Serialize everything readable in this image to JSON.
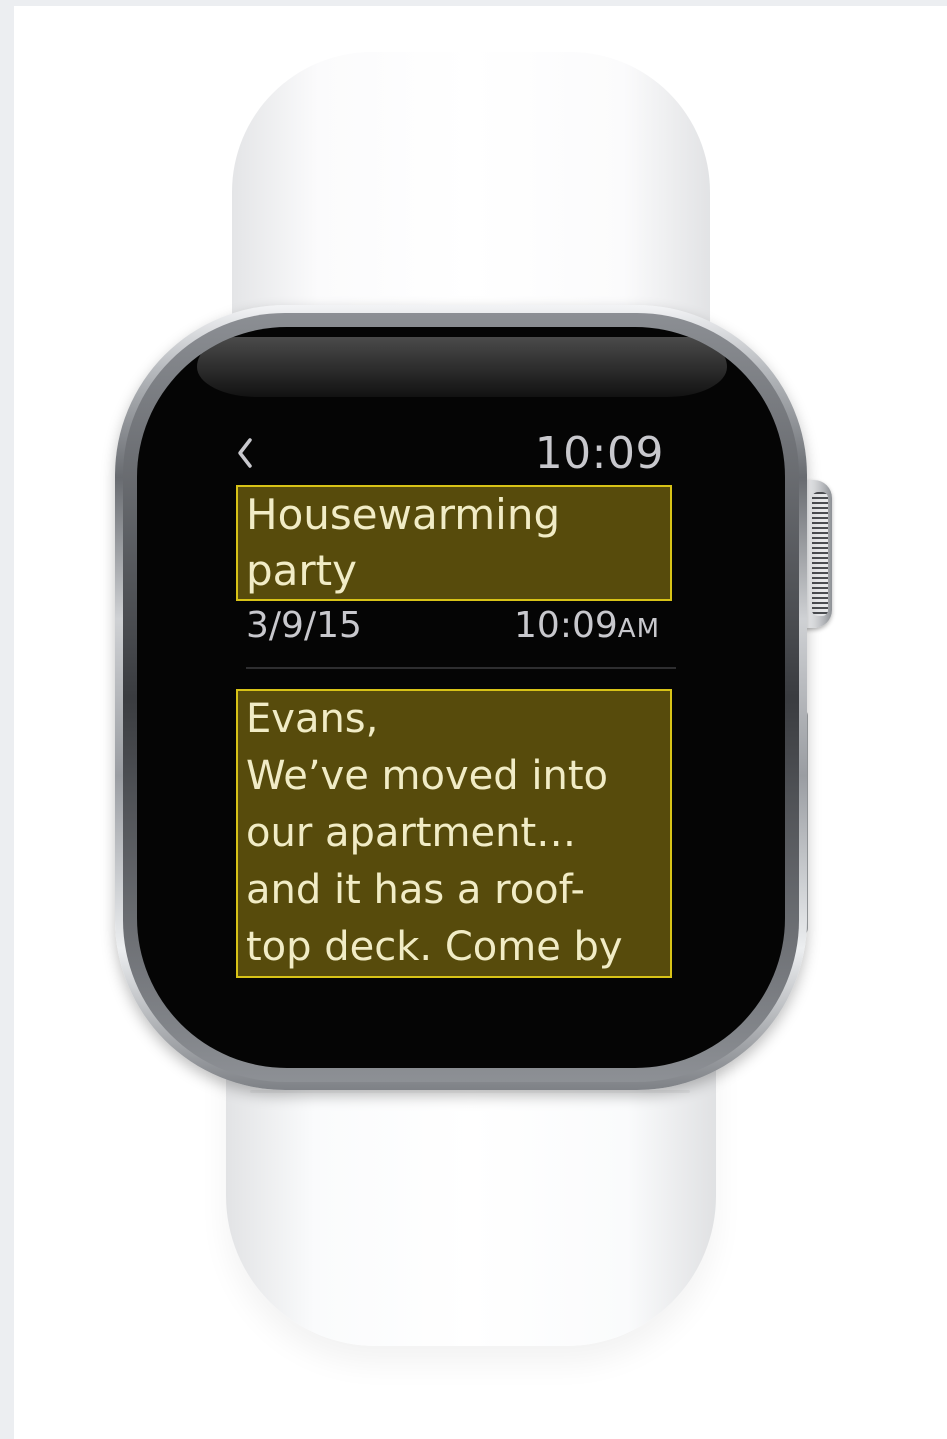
{
  "status_bar": {
    "back_icon": "chevron-left-icon",
    "time": "10:09"
  },
  "message": {
    "title": "Housewarming party",
    "date": "3/9/15",
    "time": "10:09",
    "time_suffix": "AM",
    "body_lines": [
      "Evans,",
      "We’ve moved into",
      "our apartment…",
      "and it has a roof-",
      "top deck. Come by"
    ]
  },
  "colors": {
    "highlight_fill": "#574b0c",
    "highlight_border": "#d8c317",
    "screen_background": "#050505",
    "text_secondary": "#c8c8cd"
  }
}
